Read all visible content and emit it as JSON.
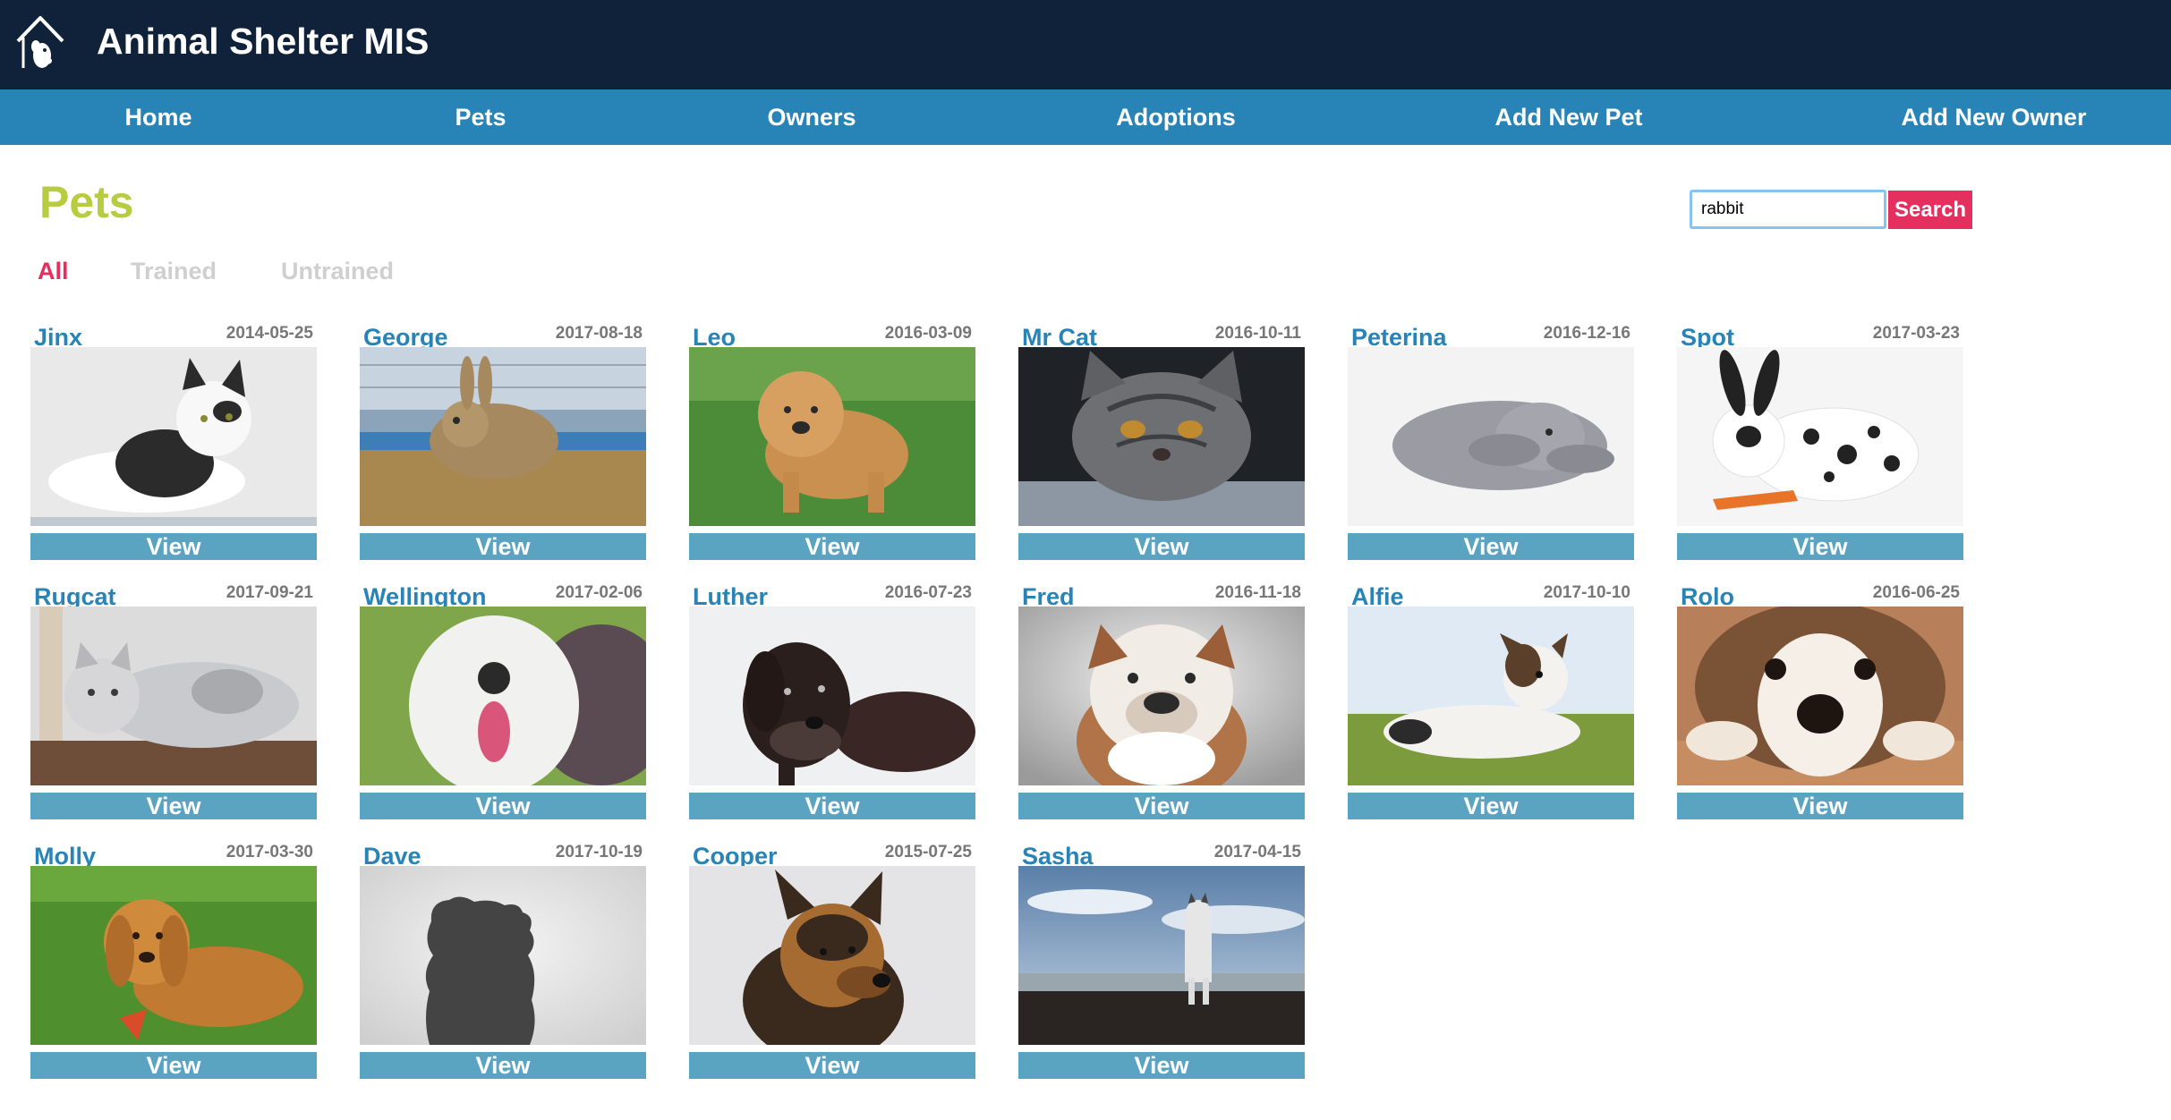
{
  "app": {
    "title": "Animal Shelter MIS",
    "logo_icon": "house-pet-logo-icon",
    "colors": {
      "header": "#10223a",
      "nav": "#2883b7",
      "accent": "#e52f5f",
      "page_title": "#b7cc3e",
      "view_button": "#5aa3c1"
    }
  },
  "nav": {
    "items": [
      {
        "label": "Home"
      },
      {
        "label": "Pets"
      },
      {
        "label": "Owners"
      },
      {
        "label": "Adoptions"
      },
      {
        "label": "Add New Pet"
      },
      {
        "label": "Add New Owner"
      }
    ]
  },
  "page": {
    "title": "Pets"
  },
  "search": {
    "value": "rabbit",
    "button_label": "Search"
  },
  "filters": {
    "items": [
      {
        "label": "All",
        "active": true
      },
      {
        "label": "Trained",
        "active": false
      },
      {
        "label": "Untrained",
        "active": false
      }
    ]
  },
  "pets": [
    {
      "name": "Jinx",
      "date": "2014-05-25",
      "photo": "white-black-cat-photo",
      "view_label": "View"
    },
    {
      "name": "George",
      "date": "2017-08-18",
      "photo": "brown-rabbit-photo",
      "view_label": "View"
    },
    {
      "name": "Leo",
      "date": "2016-03-09",
      "photo": "chow-chow-dog-photo",
      "view_label": "View"
    },
    {
      "name": "Mr Cat",
      "date": "2016-10-11",
      "photo": "tabby-cat-photo",
      "view_label": "View"
    },
    {
      "name": "Peterina",
      "date": "2016-12-16",
      "photo": "grey-lop-rabbit-photo",
      "view_label": "View"
    },
    {
      "name": "Spot",
      "date": "2017-03-23",
      "photo": "spotted-rabbit-photo",
      "view_label": "View"
    },
    {
      "name": "Rugcat",
      "date": "2017-09-21",
      "photo": "fluffy-kitten-photo",
      "view_label": "View"
    },
    {
      "name": "Wellington",
      "date": "2017-02-06",
      "photo": "sheepdog-photo",
      "view_label": "View"
    },
    {
      "name": "Luther",
      "date": "2016-07-23",
      "photo": "black-labrador-photo",
      "view_label": "View"
    },
    {
      "name": "Fred",
      "date": "2016-11-18",
      "photo": "bulldog-photo",
      "view_label": "View"
    },
    {
      "name": "Alfie",
      "date": "2017-10-10",
      "photo": "jack-russell-photo",
      "view_label": "View"
    },
    {
      "name": "Rolo",
      "date": "2016-06-25",
      "photo": "corgi-puppy-photo",
      "view_label": "View"
    },
    {
      "name": "Molly",
      "date": "2017-03-30",
      "photo": "golden-retriever-photo",
      "view_label": "View"
    },
    {
      "name": "Dave",
      "date": "2017-10-19",
      "photo": "placeholder-dog-silhouette-photo",
      "view_label": "View"
    },
    {
      "name": "Cooper",
      "date": "2015-07-25",
      "photo": "german-shepherd-photo",
      "view_label": "View"
    },
    {
      "name": "Sasha",
      "date": "2017-04-15",
      "photo": "husky-beach-photo",
      "view_label": "View"
    }
  ]
}
